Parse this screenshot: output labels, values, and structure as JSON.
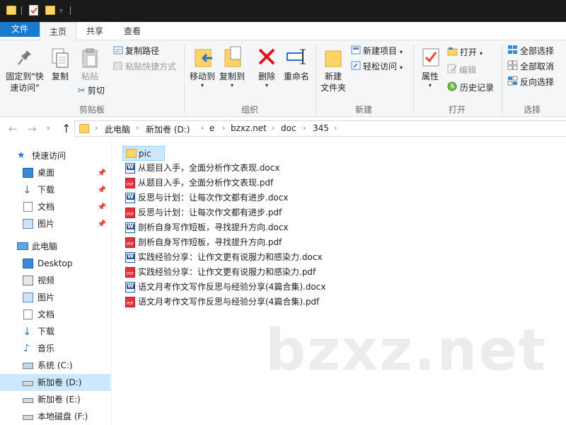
{
  "ribbon_tabs": {
    "file": "文件",
    "home": "主页",
    "share": "共享",
    "view": "查看"
  },
  "clipboard": {
    "pin_quick_access_line1": "固定到\"快",
    "pin_quick_access_line2": "速访问\"",
    "copy": "复制",
    "paste": "粘贴",
    "copy_path": "复制路径",
    "paste_shortcut": "粘贴快捷方式",
    "cut": "剪切",
    "group_label": "剪贴板"
  },
  "organize": {
    "move_to": "移动到",
    "copy_to": "复制到",
    "delete": "删除",
    "rename": "重命名",
    "group_label": "组织"
  },
  "new_group": {
    "new_folder_line1": "新建",
    "new_folder_line2": "文件夹",
    "new_item": "新建项目",
    "easy_access": "轻松访问",
    "group_label": "新建"
  },
  "open_group": {
    "properties": "属性",
    "open": "打开",
    "edit": "编辑",
    "history": "历史记录",
    "group_label": "打开"
  },
  "select_group": {
    "select_all": "全部选择",
    "select_none": "全部取消",
    "invert": "反向选择",
    "group_label": "选择"
  },
  "breadcrumb": [
    "此电脑",
    "新加卷 (D:)",
    "e",
    "bzxz.net",
    "doc",
    "345"
  ],
  "nav_pane": {
    "quick_access": "快速访问",
    "quick_items": [
      "桌面",
      "下载",
      "文档",
      "图片"
    ],
    "this_pc": "此电脑",
    "pc_items": [
      "Desktop",
      "视频",
      "图片",
      "文档",
      "下载",
      "音乐",
      "系统 (C:)",
      "新加卷 (D:)",
      "新加卷 (E:)",
      "本地磁盘 (F:)"
    ]
  },
  "files": [
    {
      "name": "pic",
      "type": "folder"
    },
    {
      "name": "从题目入手，全面分析作文表现.docx",
      "type": "docx"
    },
    {
      "name": "从题目入手，全面分析作文表现.pdf",
      "type": "pdf"
    },
    {
      "name": "反思与计划：让每次作文都有进步.docx",
      "type": "docx"
    },
    {
      "name": "反思与计划：让每次作文都有进步.pdf",
      "type": "pdf"
    },
    {
      "name": "剖析自身写作短板，寻找提升方向.docx",
      "type": "docx"
    },
    {
      "name": "剖析自身写作短板，寻找提升方向.pdf",
      "type": "pdf"
    },
    {
      "name": "实践经验分享：让作文更有说服力和感染力.docx",
      "type": "docx"
    },
    {
      "name": "实践经验分享：让作文更有说服力和感染力.pdf",
      "type": "pdf"
    },
    {
      "name": "语文月考作文写作反思与经验分享(4篇合集).docx",
      "type": "docx"
    },
    {
      "name": "语文月考作文写作反思与经验分享(4篇合集).pdf",
      "type": "pdf"
    }
  ],
  "watermark": "bzxz.net",
  "colors": {
    "file_tab": "#1979ca",
    "selection": "#cce8ff",
    "folder": "#ffd466",
    "delete_red": "#e81123",
    "pdf_red": "#e2333d",
    "word_blue": "#2b5797"
  }
}
